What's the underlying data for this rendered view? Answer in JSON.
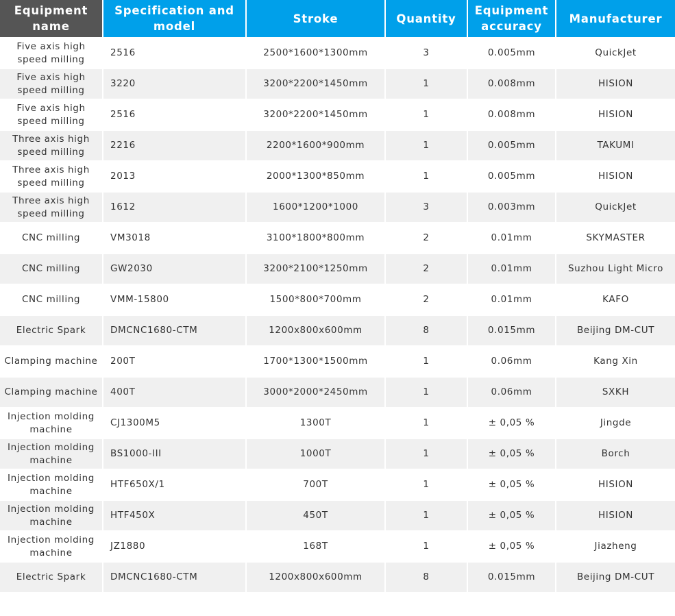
{
  "headers": {
    "name": "Equipment name",
    "model": "Specification and model",
    "stroke": "Stroke",
    "quantity": "Quantity",
    "accuracy": "Equipment accuracy",
    "manufacturer": "Manufacturer"
  },
  "rows": [
    {
      "name": "Five axis high speed milling",
      "model": "2516",
      "stroke": "2500*1600*1300mm",
      "quantity": "3",
      "accuracy": "0.005mm",
      "manufacturer": "QuickJet"
    },
    {
      "name": "Five axis high speed milling",
      "model": "3220",
      "stroke": "3200*2200*1450mm",
      "quantity": "1",
      "accuracy": "0.008mm",
      "manufacturer": "HISION"
    },
    {
      "name": "Five axis high speed milling",
      "model": "2516",
      "stroke": "3200*2200*1450mm",
      "quantity": "1",
      "accuracy": "0.008mm",
      "manufacturer": "HISION"
    },
    {
      "name": "Three axis high speed milling",
      "model": "2216",
      "stroke": "2200*1600*900mm",
      "quantity": "1",
      "accuracy": "0.005mm",
      "manufacturer": "TAKUMI"
    },
    {
      "name": "Three axis high speed milling",
      "model": "2013",
      "stroke": "2000*1300*850mm",
      "quantity": "1",
      "accuracy": "0.005mm",
      "manufacturer": "HISION"
    },
    {
      "name": "Three axis high speed milling",
      "model": "1612",
      "stroke": "1600*1200*1000",
      "quantity": "3",
      "accuracy": "0.003mm",
      "manufacturer": "QuickJet"
    },
    {
      "name": "CNC milling",
      "model": "VM3018",
      "stroke": "3100*1800*800mm",
      "quantity": "2",
      "accuracy": "0.01mm",
      "manufacturer": "SKYMASTER"
    },
    {
      "name": "CNC milling",
      "model": "GW2030",
      "stroke": "3200*2100*1250mm",
      "quantity": "2",
      "accuracy": "0.01mm",
      "manufacturer": "Suzhou Light Micro"
    },
    {
      "name": "CNC milling",
      "model": "VMM-15800",
      "stroke": "1500*800*700mm",
      "quantity": "2",
      "accuracy": "0.01mm",
      "manufacturer": "KAFO"
    },
    {
      "name": "Electric Spark",
      "model": "DMCNC1680-CTM",
      "stroke": "1200x800x600mm",
      "quantity": "8",
      "accuracy": "0.015mm",
      "manufacturer": "Beijing DM-CUT"
    },
    {
      "name": "Clamping machine",
      "model": "200T",
      "stroke": "1700*1300*1500mm",
      "quantity": "1",
      "accuracy": "0.06mm",
      "manufacturer": "Kang Xin"
    },
    {
      "name": "Clamping machine",
      "model": "400T",
      "stroke": "3000*2000*2450mm",
      "quantity": "1",
      "accuracy": "0.06mm",
      "manufacturer": "SXKH"
    },
    {
      "name": "Injection molding machine",
      "model": "CJ1300M5",
      "stroke": "1300T",
      "quantity": "1",
      "accuracy": "± 0,05 %",
      "manufacturer": "Jingde"
    },
    {
      "name": "Injection molding machine",
      "model": "BS1000-III",
      "stroke": "1000T",
      "quantity": "1",
      "accuracy": "± 0,05 %",
      "manufacturer": "Borch"
    },
    {
      "name": "Injection molding machine",
      "model": "HTF650X/1",
      "stroke": "700T",
      "quantity": "1",
      "accuracy": "± 0,05 %",
      "manufacturer": "HISION"
    },
    {
      "name": "Injection molding machine",
      "model": "HTF450X",
      "stroke": "450T",
      "quantity": "1",
      "accuracy": "± 0,05 %",
      "manufacturer": "HISION"
    },
    {
      "name": "Injection molding machine",
      "model": "JZ1880",
      "stroke": "168T",
      "quantity": "1",
      "accuracy": "± 0,05 %",
      "manufacturer": "Jiazheng"
    },
    {
      "name": "Electric Spark",
      "model": "DMCNC1680-CTM",
      "stroke": "1200x800x600mm",
      "quantity": "8",
      "accuracy": "0.015mm",
      "manufacturer": "Beijing DM-CUT"
    }
  ]
}
